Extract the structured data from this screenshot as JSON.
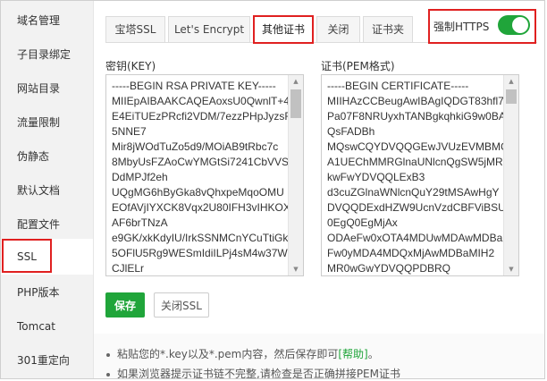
{
  "sidebar": {
    "items": [
      {
        "label": "域名管理"
      },
      {
        "label": "子目录绑定"
      },
      {
        "label": "网站目录"
      },
      {
        "label": "流量限制"
      },
      {
        "label": "伪静态"
      },
      {
        "label": "默认文档"
      },
      {
        "label": "配置文件"
      },
      {
        "label": "SSL"
      },
      {
        "label": "PHP版本"
      },
      {
        "label": "Tomcat"
      },
      {
        "label": "301重定向"
      }
    ],
    "active": "SSL"
  },
  "tabs": [
    {
      "label": "宝塔SSL"
    },
    {
      "label": "Let's Encrypt"
    },
    {
      "label": "其他证书"
    },
    {
      "label": "关闭"
    },
    {
      "label": "证书夹"
    }
  ],
  "active_tab": "其他证书",
  "https": {
    "label": "强制HTTPS",
    "enabled": true,
    "color": "#20a53a"
  },
  "key_field": {
    "label": "密钥(KEY)",
    "value": "-----BEGIN RSA PRIVATE KEY-----\nMIIEpAIBAAKCAQEAoxsU0QwnlT+4\nE4EiTUEzPRcfi2VDM/7ezzPHpJyzsF4\n5NNE7\nMir8jWOdTuZo5d9/MOiAB9tRbc7c\n8MbyUsFZAoCwYMGtSi7241CbVVS\nDdMPJf2eh\nUQgMG6hByGka8vQhxpeMqoOMU\nEOfAVjIYXCK8Vqx2U80IFH3vIHKOXI\nAF6brTNzA\ne9GK/xkKdyIU/IrkSSNMCnYCuTtiGk\n5OFlU5Rg9WESmIdiILPj4sM4w37W\nCJlELr"
  },
  "cert_field": {
    "label": "证书(PEM格式)",
    "value": "-----BEGIN CERTIFICATE-----\nMIIHAzCCBeugAwIBAgIQDGT83hfl7\nPa07F8NRUyxhTANBgkqhkiG9w0BA\nQsFADBh\nMQswCQYDVQQGEwJVUzEVMBMG\nA1UEChMMRGlnaUNlcnQgSW5jMR\nkwFwYDVQQLExB3\nd3cuZGlnaWNlcnQuY29tMSAwHgY\nDVQQDExdHZW9UcnVzdCBFViBSU\n0EgQ0EgMjAx\nODAeFw0xOTA4MDUwMDAwMDBa\nFw0yMDA4MDQxMjAwMDBaMIH2\nMR0wGwYDVQQPDBRQ"
  },
  "buttons": {
    "save": "保存",
    "close_ssl": "关闭SSL"
  },
  "notes": {
    "line1_text": "粘贴您的*.key以及*.pem内容，然后保存即可",
    "help_link": "[帮助]",
    "line1_end": "。",
    "line2_text": "如果浏览器提示证书链不完整,请检查是否正确拼接PEM证书"
  }
}
